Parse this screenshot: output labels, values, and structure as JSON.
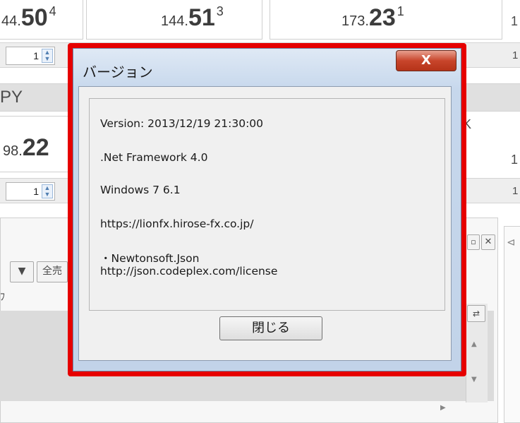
{
  "background": {
    "rates": [
      {
        "prefix": "44.",
        "main": "50",
        "sup": "4"
      },
      {
        "prefix": "144.",
        "main": "51",
        "sup": "3"
      },
      {
        "prefix": "173.",
        "main": "23",
        "sup": "1"
      },
      {
        "prefix": "98.",
        "main": "22",
        "sup": ""
      }
    ],
    "edge_chars": [
      "1",
      "1",
      "1",
      "1"
    ],
    "stepper_value": "1",
    "pair_label": "PY",
    "right_letter": "K",
    "filter_label": "全売",
    "partial_label": "ﾌ"
  },
  "dialog": {
    "title": "バージョン",
    "close_label": "X",
    "lines": [
      "Version: 2013/12/19 21:30:00",
      ".Net Framework 4.0",
      "Windows 7 6.1",
      "https://lionfx.hirose-fx.co.jp/"
    ],
    "license_name": "・Newtonsoft.Json",
    "license_url": "http://json.codeplex.com/license",
    "ok_label": "閉じる"
  },
  "colors": {
    "highlight": "#e60000",
    "close_button": "#c8452b"
  }
}
